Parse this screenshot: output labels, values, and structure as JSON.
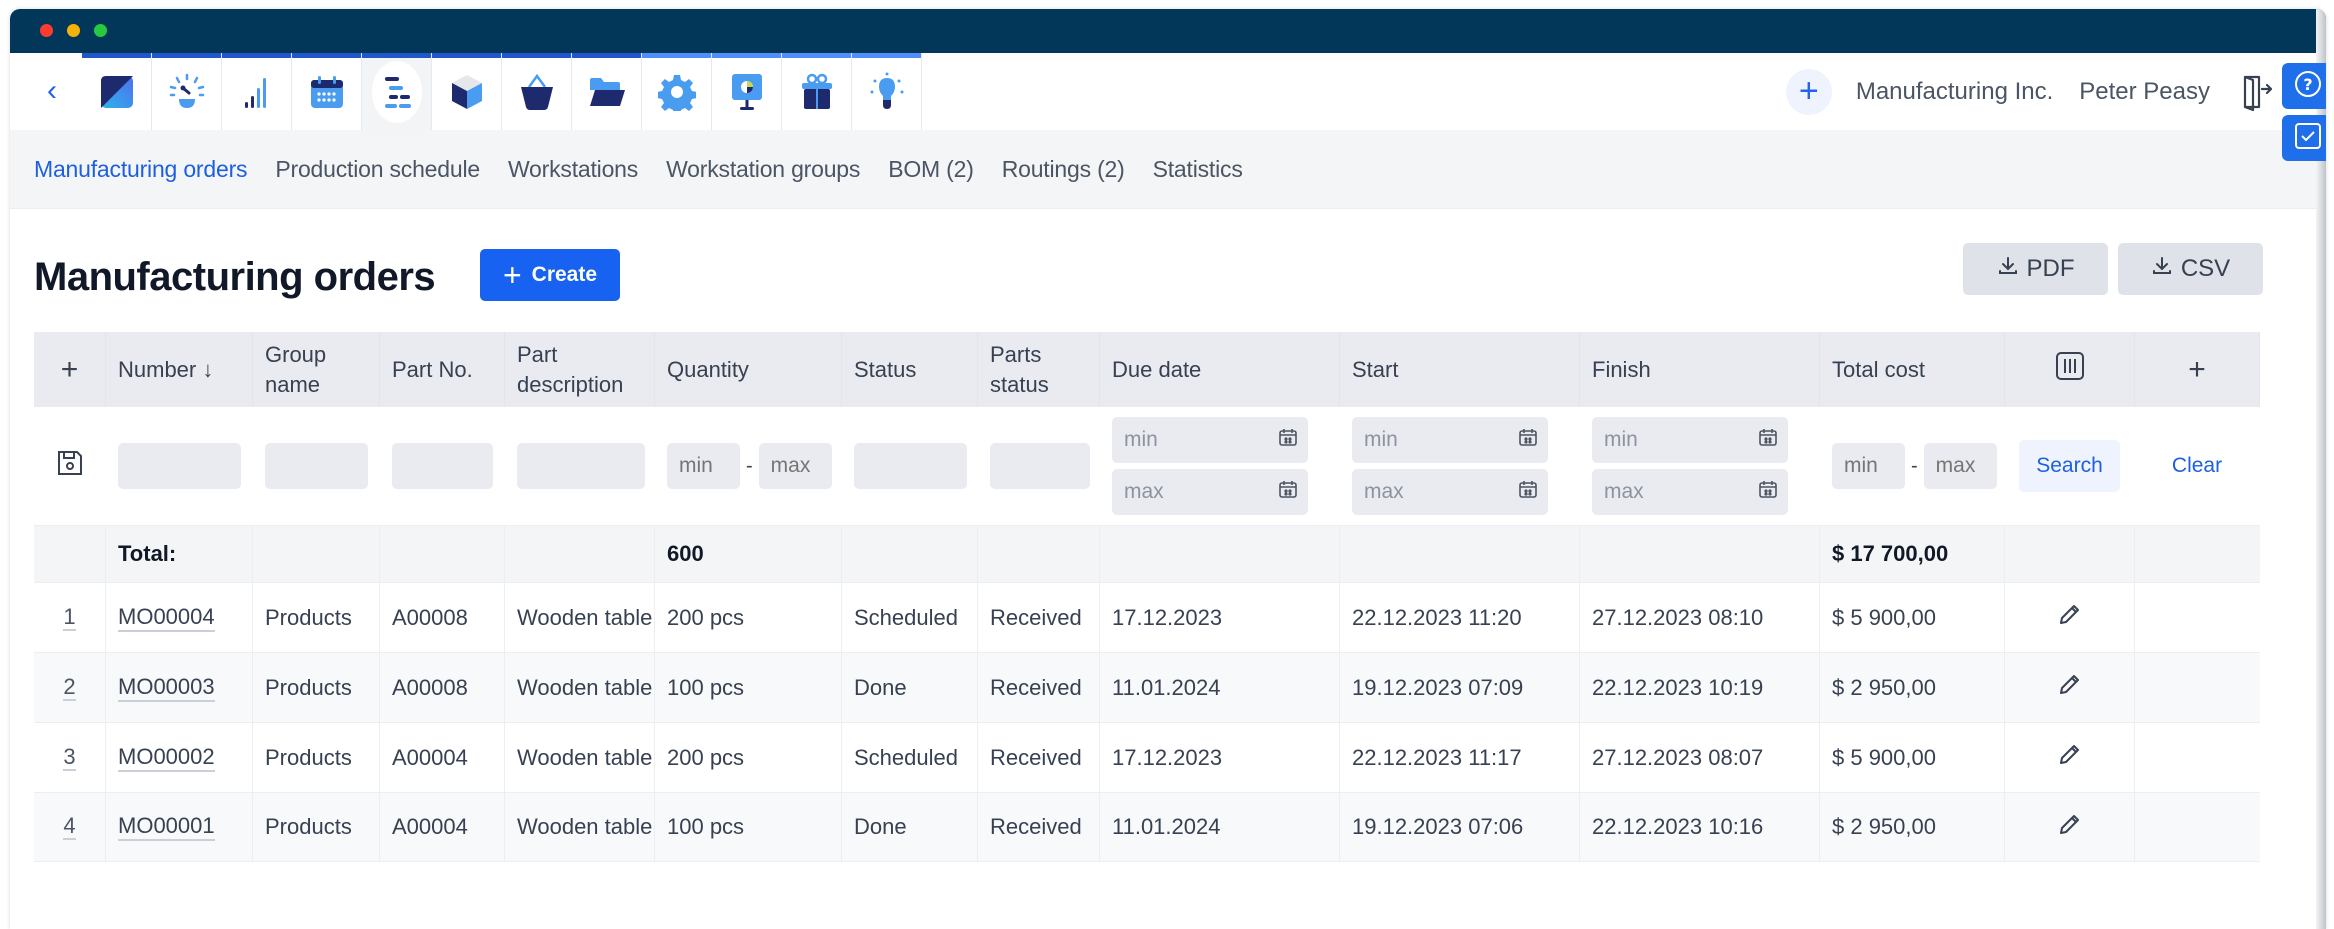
{
  "window": {
    "controls": [
      "close",
      "minimize",
      "maximize"
    ]
  },
  "navbar": {
    "back_icon": "chevron-left-icon",
    "apps": [
      {
        "icon": "dashboard-logo-icon"
      },
      {
        "icon": "gauge-icon"
      },
      {
        "icon": "bar-signal-icon"
      },
      {
        "icon": "calendar-icon"
      },
      {
        "icon": "production-schedule-icon",
        "active": true
      },
      {
        "icon": "cube-icon"
      },
      {
        "icon": "basket-icon"
      },
      {
        "icon": "folder-open-icon"
      },
      {
        "icon": "gear-icon"
      },
      {
        "icon": "presentation-chart-icon"
      },
      {
        "icon": "gift-icon"
      },
      {
        "icon": "lightbulb-icon"
      }
    ],
    "add_label": "+",
    "company": "Manufacturing Inc.",
    "user": "Peter Peasy",
    "logout_icon": "logout-door-icon"
  },
  "side_buttons": [
    {
      "icon": "help-circle-icon"
    },
    {
      "icon": "checkbox-icon"
    }
  ],
  "subtabs": [
    {
      "label": "Manufacturing orders",
      "active": true
    },
    {
      "label": "Production schedule"
    },
    {
      "label": "Workstations"
    },
    {
      "label": "Workstation groups"
    },
    {
      "label": "BOM (2)"
    },
    {
      "label": "Routings (2)"
    },
    {
      "label": "Statistics"
    }
  ],
  "page": {
    "title": "Manufacturing orders",
    "create_label": "Create",
    "pdf_label": "PDF",
    "csv_label": "CSV"
  },
  "table": {
    "headers": {
      "add": "+",
      "number": "Number ↓",
      "group_name": "Group name",
      "part_no": "Part No.",
      "part_description": "Part description",
      "quantity": "Quantity",
      "status": "Status",
      "parts_status": "Parts status",
      "due_date": "Due date",
      "start": "Start",
      "finish": "Finish",
      "total_cost": "Total cost",
      "add_col": "+"
    },
    "filters": {
      "min_placeholder": "min",
      "max_placeholder": "max",
      "dash": "-",
      "search_label": "Search",
      "clear_label": "Clear"
    },
    "totals": {
      "label": "Total:",
      "quantity": "600",
      "total_cost": "$ 17 700,00"
    },
    "rows": [
      {
        "index": "1",
        "number": "MO00004",
        "group": "Products",
        "part_no": "A00008",
        "part_desc": "Wooden table",
        "quantity": "200 pcs",
        "status": "Scheduled",
        "parts_status": "Received",
        "due_date": "17.12.2023",
        "start": "22.12.2023 11:20",
        "finish": "27.12.2023 08:10",
        "total_cost": "$ 5 900,00"
      },
      {
        "index": "2",
        "number": "MO00003",
        "group": "Products",
        "part_no": "A00008",
        "part_desc": "Wooden table",
        "quantity": "100 pcs",
        "status": "Done",
        "parts_status": "Received",
        "due_date": "11.01.2024",
        "start": "19.12.2023 07:09",
        "finish": "22.12.2023 10:19",
        "total_cost": "$ 2 950,00"
      },
      {
        "index": "3",
        "number": "MO00002",
        "group": "Products",
        "part_no": "A00004",
        "part_desc": "Wooden table",
        "quantity": "200 pcs",
        "status": "Scheduled",
        "parts_status": "Received",
        "due_date": "17.12.2023",
        "start": "22.12.2023 11:17",
        "finish": "27.12.2023 08:07",
        "total_cost": "$ 5 900,00"
      },
      {
        "index": "4",
        "number": "MO00001",
        "group": "Products",
        "part_no": "A00004",
        "part_desc": "Wooden table",
        "quantity": "100 pcs",
        "status": "Done",
        "parts_status": "Received",
        "due_date": "11.01.2024",
        "start": "19.12.2023 07:06",
        "finish": "22.12.2023 10:16",
        "total_cost": "$ 2 950,00"
      }
    ]
  },
  "colors": {
    "titlebar": "#02375a",
    "accent": "#1762f0",
    "link": "#1d5fe0",
    "header_bg": "#e9ebf0"
  }
}
